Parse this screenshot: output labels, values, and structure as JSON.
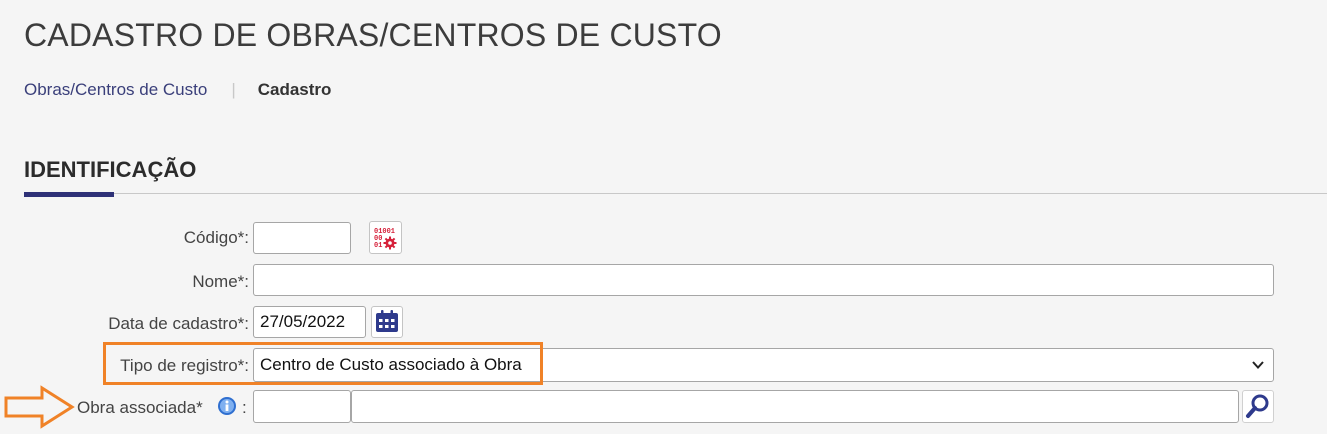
{
  "page": {
    "title": "CADASTRO DE OBRAS/CENTROS DE CUSTO"
  },
  "breadcrumb": {
    "parent": "Obras/Centros de Custo",
    "separator": "|",
    "current": "Cadastro"
  },
  "section": {
    "title": "IDENTIFICAÇÃO"
  },
  "form": {
    "codigo": {
      "label": "Código*:",
      "value": ""
    },
    "nome": {
      "label": "Nome*:",
      "value": ""
    },
    "data": {
      "label": "Data de cadastro*:",
      "value": "27/05/2022"
    },
    "tipo": {
      "label": "Tipo de registro*:",
      "value": "Centro de Custo associado à Obra"
    },
    "obra": {
      "label": "Obra associada*",
      "colon": ":",
      "code_value": "",
      "name_value": ""
    }
  },
  "icons": {
    "generate_code": "binary-gear-icon",
    "calendar": "calendar-icon",
    "info": "info-icon",
    "search": "search-icon",
    "dropdown": "chevron-down-icon",
    "annotation": "orange-arrow-icon"
  },
  "colors": {
    "accent": "#2e3177",
    "link": "#3a3f7a",
    "highlight": "#f08227",
    "code_icon": "#d6213a"
  }
}
